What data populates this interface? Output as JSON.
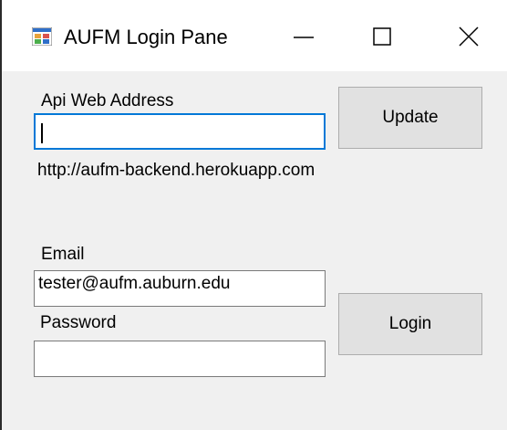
{
  "window": {
    "title": "AUFM Login Pane",
    "app_icon": "winforms-app-icon",
    "controls": {
      "minimize_icon": "minimize-icon",
      "maximize_icon": "maximize-icon",
      "close_icon": "close-icon"
    }
  },
  "api": {
    "label": "Api Web Address",
    "value": "",
    "current_address": "http://aufm-backend.herokuapp.com",
    "update_label": "Update"
  },
  "login": {
    "email_label": "Email",
    "email_value": "tester@aufm.auburn.edu",
    "password_label": "Password",
    "password_value": "",
    "login_label": "Login"
  },
  "colors": {
    "focus_border": "#0078d7",
    "window_bg": "#f0f0f0",
    "button_bg": "#e1e1e1"
  }
}
